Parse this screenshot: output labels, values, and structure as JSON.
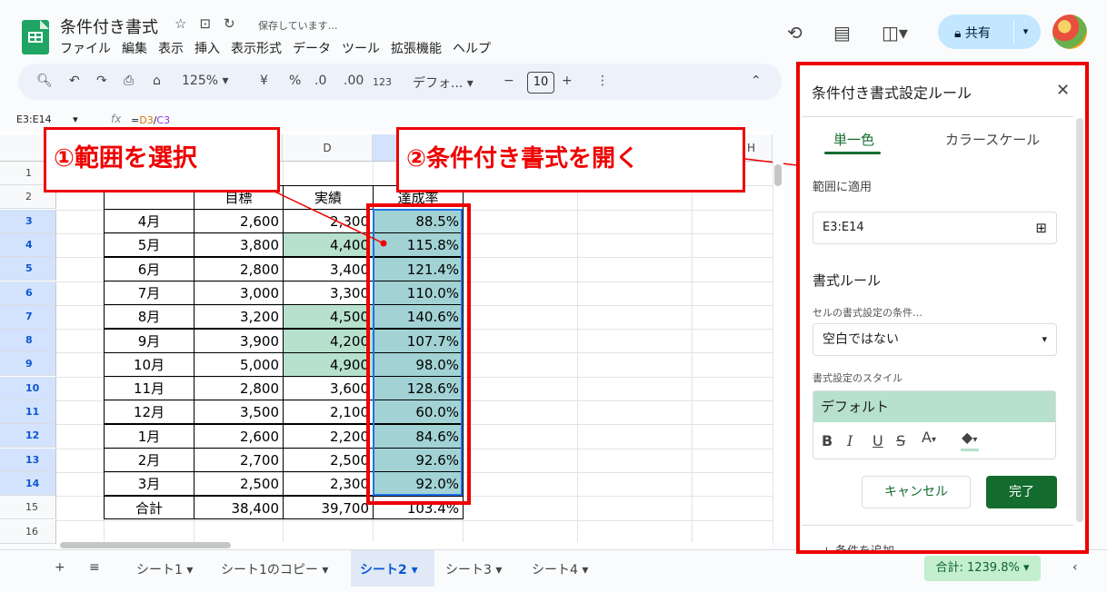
{
  "app": {
    "title": "条件付き書式",
    "saving": "保存しています…",
    "menu": [
      "ファイル",
      "編集",
      "表示",
      "挿入",
      "表示形式",
      "データ",
      "ツール",
      "拡張機能",
      "ヘルプ"
    ],
    "share_label": "共有",
    "icons": [
      "star-icon",
      "move-folder-icon",
      "cloud-sync-icon",
      "history-icon",
      "comment-icon",
      "meet-icon"
    ]
  },
  "toolbar": {
    "zoom": "125%",
    "currency": "¥",
    "percent": "%",
    "dec_decrease": ".0",
    "dec_increase": ".00",
    "format_123": "123",
    "font": "デフォ...",
    "font_size": "10",
    "minus": "−",
    "plus": "+"
  },
  "formula_bar": {
    "namebox": "E3:E14",
    "fx": "fx",
    "ref1": "D3",
    "op": "/",
    "ref2": "C3"
  },
  "grid": {
    "col_d": "D",
    "col_h": "H",
    "row_numbers": [
      "1",
      "2",
      "3",
      "4",
      "5",
      "6",
      "7",
      "8",
      "9",
      "10",
      "11",
      "12",
      "13",
      "14",
      "15",
      "16"
    ],
    "headers": [
      "目標",
      "実績",
      "達成率"
    ],
    "rows": [
      {
        "month": "4月",
        "target": "2,600",
        "actual": "2,300",
        "rate": "88.5%"
      },
      {
        "month": "5月",
        "target": "3,800",
        "actual": "4,400",
        "rate": "115.8%"
      },
      {
        "month": "6月",
        "target": "2,800",
        "actual": "3,400",
        "rate": "121.4%"
      },
      {
        "month": "7月",
        "target": "3,000",
        "actual": "3,300",
        "rate": "110.0%"
      },
      {
        "month": "8月",
        "target": "3,200",
        "actual": "4,500",
        "rate": "140.6%"
      },
      {
        "month": "9月",
        "target": "3,900",
        "actual": "4,200",
        "rate": "107.7%"
      },
      {
        "month": "10月",
        "target": "5,000",
        "actual": "4,900",
        "rate": "98.0%"
      },
      {
        "month": "11月",
        "target": "2,800",
        "actual": "3,600",
        "rate": "128.6%"
      },
      {
        "month": "12月",
        "target": "3,500",
        "actual": "2,100",
        "rate": "60.0%"
      },
      {
        "month": "1月",
        "target": "2,600",
        "actual": "2,200",
        "rate": "84.6%"
      },
      {
        "month": "2月",
        "target": "2,700",
        "actual": "2,500",
        "rate": "92.6%"
      },
      {
        "month": "3月",
        "target": "2,500",
        "actual": "2,300",
        "rate": "92.0%"
      }
    ],
    "total": {
      "label": "合計",
      "target": "38,400",
      "actual": "39,700",
      "rate": "103.4%"
    }
  },
  "annotations": {
    "step1": "①範囲を選択",
    "step2": "②条件付き書式を開く",
    "color": "#e00000"
  },
  "sheets": {
    "tabs": [
      "シート1",
      "シート1のコピー",
      "シート2",
      "シート3",
      "シート4"
    ],
    "active": "シート2",
    "sum": "合計: 1239.8%"
  },
  "panel": {
    "title": "条件付き書式設定ルール",
    "tab_single": "単一色",
    "tab_scale": "カラースケール",
    "range_label": "範囲に適用",
    "range_value": "E3:E14",
    "rules_heading": "書式ルール",
    "condition_label": "セルの書式設定の条件…",
    "condition_value": "空白ではない",
    "style_label": "書式設定のスタイル",
    "style_preview": "デフォルト",
    "cancel": "キャンセル",
    "done": "完了",
    "add_condition": "+ 条件を追加"
  },
  "colors": {
    "green_fill": "#b7e1cd",
    "teal_fill": "#a2d2d4",
    "accent": "#146c2e",
    "share": "#c2e7ff"
  }
}
